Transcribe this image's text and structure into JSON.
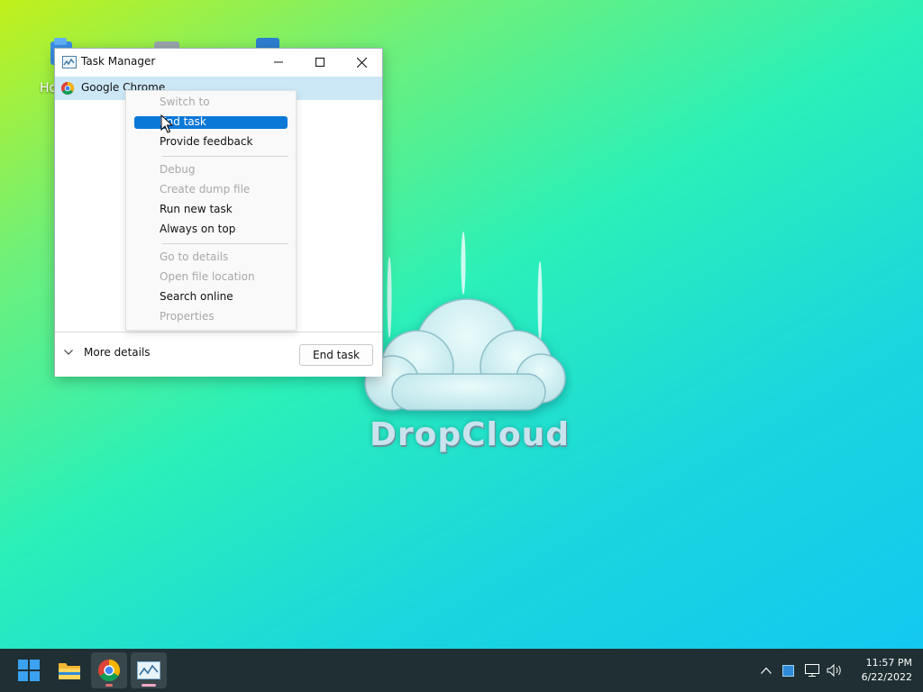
{
  "desktop": {
    "label_partial": "Ho",
    "wallpaper_logo_text": "DropCloud"
  },
  "task_manager": {
    "title": "Task Manager",
    "process_row": "Google Chrome",
    "more_details": "More details",
    "end_task_button": "End task"
  },
  "context_menu": {
    "items": [
      {
        "label": "Switch to",
        "enabled": false
      },
      {
        "label": "End task",
        "enabled": true,
        "highlighted": true
      },
      {
        "label": "Provide feedback",
        "enabled": true
      },
      {
        "label": "Debug",
        "enabled": false
      },
      {
        "label": "Create dump file",
        "enabled": false
      },
      {
        "label": "Run new task",
        "enabled": true
      },
      {
        "label": "Always on top",
        "enabled": true
      },
      {
        "label": "Go to details",
        "enabled": false
      },
      {
        "label": "Open file location",
        "enabled": false
      },
      {
        "label": "Search online",
        "enabled": true
      },
      {
        "label": "Properties",
        "enabled": false
      }
    ]
  },
  "taskbar": {
    "apps": [
      "start-icon",
      "file-explorer-icon",
      "chrome-icon",
      "task-manager-icon"
    ],
    "clock": {
      "time": "11:57 PM",
      "date": "6/22/2022"
    }
  },
  "colors": {
    "highlight": "#0a78d7",
    "row_selected": "#cce8f6",
    "taskbar": "#1f2f33"
  }
}
